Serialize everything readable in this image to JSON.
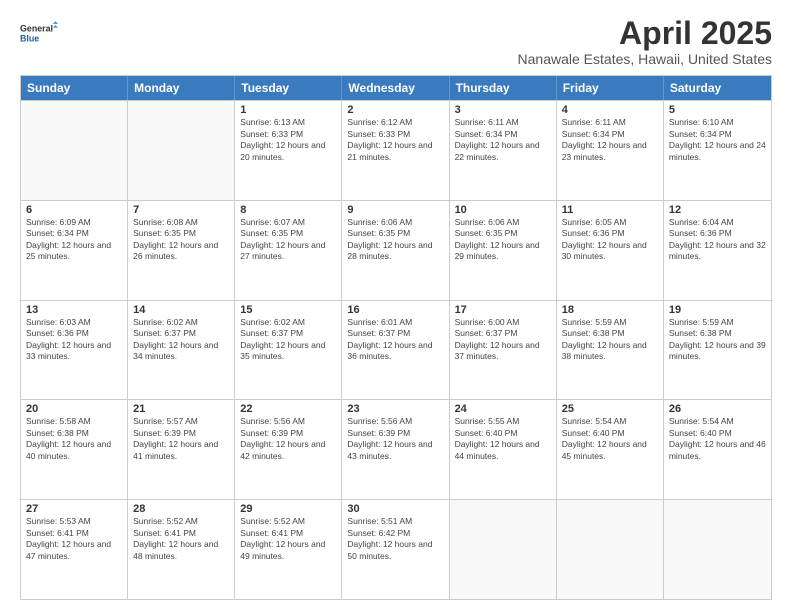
{
  "logo": {
    "line1": "General",
    "line2": "Blue"
  },
  "title": "April 2025",
  "subtitle": "Nanawale Estates, Hawaii, United States",
  "days_of_week": [
    "Sunday",
    "Monday",
    "Tuesday",
    "Wednesday",
    "Thursday",
    "Friday",
    "Saturday"
  ],
  "weeks": [
    [
      {
        "day": "",
        "empty": true
      },
      {
        "day": "",
        "empty": true
      },
      {
        "day": "1",
        "sunrise": "6:13 AM",
        "sunset": "6:33 PM",
        "daylight": "12 hours and 20 minutes."
      },
      {
        "day": "2",
        "sunrise": "6:12 AM",
        "sunset": "6:33 PM",
        "daylight": "12 hours and 21 minutes."
      },
      {
        "day": "3",
        "sunrise": "6:11 AM",
        "sunset": "6:34 PM",
        "daylight": "12 hours and 22 minutes."
      },
      {
        "day": "4",
        "sunrise": "6:11 AM",
        "sunset": "6:34 PM",
        "daylight": "12 hours and 23 minutes."
      },
      {
        "day": "5",
        "sunrise": "6:10 AM",
        "sunset": "6:34 PM",
        "daylight": "12 hours and 24 minutes."
      }
    ],
    [
      {
        "day": "6",
        "sunrise": "6:09 AM",
        "sunset": "6:34 PM",
        "daylight": "12 hours and 25 minutes."
      },
      {
        "day": "7",
        "sunrise": "6:08 AM",
        "sunset": "6:35 PM",
        "daylight": "12 hours and 26 minutes."
      },
      {
        "day": "8",
        "sunrise": "6:07 AM",
        "sunset": "6:35 PM",
        "daylight": "12 hours and 27 minutes."
      },
      {
        "day": "9",
        "sunrise": "6:06 AM",
        "sunset": "6:35 PM",
        "daylight": "12 hours and 28 minutes."
      },
      {
        "day": "10",
        "sunrise": "6:06 AM",
        "sunset": "6:35 PM",
        "daylight": "12 hours and 29 minutes."
      },
      {
        "day": "11",
        "sunrise": "6:05 AM",
        "sunset": "6:36 PM",
        "daylight": "12 hours and 30 minutes."
      },
      {
        "day": "12",
        "sunrise": "6:04 AM",
        "sunset": "6:36 PM",
        "daylight": "12 hours and 32 minutes."
      }
    ],
    [
      {
        "day": "13",
        "sunrise": "6:03 AM",
        "sunset": "6:36 PM",
        "daylight": "12 hours and 33 minutes."
      },
      {
        "day": "14",
        "sunrise": "6:02 AM",
        "sunset": "6:37 PM",
        "daylight": "12 hours and 34 minutes."
      },
      {
        "day": "15",
        "sunrise": "6:02 AM",
        "sunset": "6:37 PM",
        "daylight": "12 hours and 35 minutes."
      },
      {
        "day": "16",
        "sunrise": "6:01 AM",
        "sunset": "6:37 PM",
        "daylight": "12 hours and 36 minutes."
      },
      {
        "day": "17",
        "sunrise": "6:00 AM",
        "sunset": "6:37 PM",
        "daylight": "12 hours and 37 minutes."
      },
      {
        "day": "18",
        "sunrise": "5:59 AM",
        "sunset": "6:38 PM",
        "daylight": "12 hours and 38 minutes."
      },
      {
        "day": "19",
        "sunrise": "5:59 AM",
        "sunset": "6:38 PM",
        "daylight": "12 hours and 39 minutes."
      }
    ],
    [
      {
        "day": "20",
        "sunrise": "5:58 AM",
        "sunset": "6:38 PM",
        "daylight": "12 hours and 40 minutes."
      },
      {
        "day": "21",
        "sunrise": "5:57 AM",
        "sunset": "6:39 PM",
        "daylight": "12 hours and 41 minutes."
      },
      {
        "day": "22",
        "sunrise": "5:56 AM",
        "sunset": "6:39 PM",
        "daylight": "12 hours and 42 minutes."
      },
      {
        "day": "23",
        "sunrise": "5:56 AM",
        "sunset": "6:39 PM",
        "daylight": "12 hours and 43 minutes."
      },
      {
        "day": "24",
        "sunrise": "5:55 AM",
        "sunset": "6:40 PM",
        "daylight": "12 hours and 44 minutes."
      },
      {
        "day": "25",
        "sunrise": "5:54 AM",
        "sunset": "6:40 PM",
        "daylight": "12 hours and 45 minutes."
      },
      {
        "day": "26",
        "sunrise": "5:54 AM",
        "sunset": "6:40 PM",
        "daylight": "12 hours and 46 minutes."
      }
    ],
    [
      {
        "day": "27",
        "sunrise": "5:53 AM",
        "sunset": "6:41 PM",
        "daylight": "12 hours and 47 minutes."
      },
      {
        "day": "28",
        "sunrise": "5:52 AM",
        "sunset": "6:41 PM",
        "daylight": "12 hours and 48 minutes."
      },
      {
        "day": "29",
        "sunrise": "5:52 AM",
        "sunset": "6:41 PM",
        "daylight": "12 hours and 49 minutes."
      },
      {
        "day": "30",
        "sunrise": "5:51 AM",
        "sunset": "6:42 PM",
        "daylight": "12 hours and 50 minutes."
      },
      {
        "day": "",
        "empty": true
      },
      {
        "day": "",
        "empty": true
      },
      {
        "day": "",
        "empty": true
      }
    ]
  ]
}
